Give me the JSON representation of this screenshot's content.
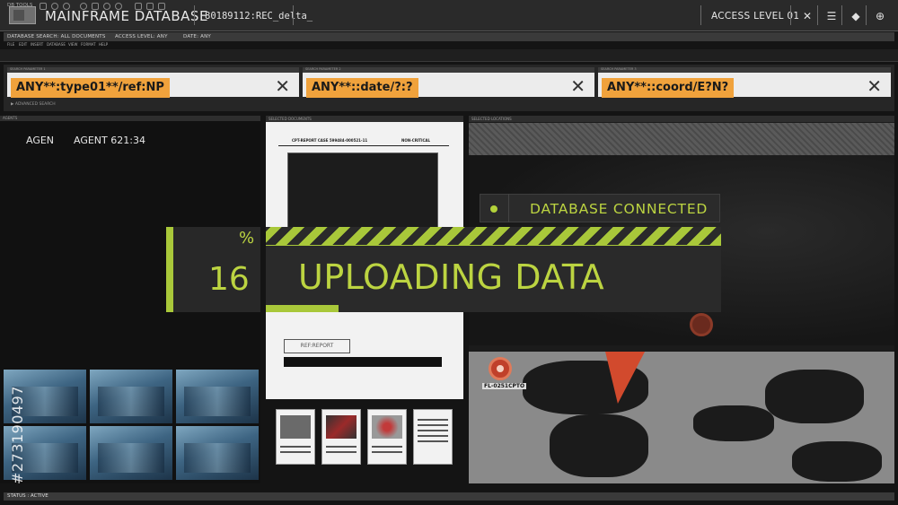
{
  "header": {
    "title": "MAINFRAME DATABASE",
    "record_id": "80189112:REC_delta_",
    "access_level": "ACCESS LEVEL 01",
    "icons": [
      "network-icon",
      "list-icon",
      "layers-icon",
      "globe-icon"
    ]
  },
  "filters": {
    "database_search": "DATABASE SEARCH: ALL DOCUMENTS",
    "access_level": "ACCESS LEVEL: ANY",
    "date": "DATE: ANY"
  },
  "menu": [
    "FILE",
    "EDIT",
    "INSERT",
    "DATABASE",
    "VIEW",
    "FORMAT",
    "HELP"
  ],
  "toolbar": {
    "label": "DB TOOLS"
  },
  "searches": [
    {
      "label": "SEARCH PARAMETER 1",
      "query": "ANY**:type01**/ref:NP"
    },
    {
      "label": "SEARCH PARAMETER 2",
      "query": "ANY**::date/?:?"
    },
    {
      "label": "SEARCH PARAMETER 3",
      "query": "ANY**::coord/E?N?"
    }
  ],
  "advanced_search": "ADVANCED SEARCH",
  "agents": {
    "header": "AGENTS",
    "tag": "AGEN",
    "name": "AGENT 621:34"
  },
  "document": {
    "header": "SELECTED DOCUMENTS",
    "report_title": "CPT-REPORT CASE 599484-000521-11",
    "classification": "NON-CRITICAL",
    "stamp": "REF:REPORT"
  },
  "map": {
    "header": "SELECTED LOCATIONS",
    "pin_label": "FL-0251CPTO"
  },
  "overlay": {
    "connection": "DATABASE CONNECTED",
    "percent_sign": "%",
    "percent": "16",
    "progress": 0.16,
    "message": "UPLOADING DATA"
  },
  "status": "STATUS : ACTIVE",
  "watermark_id": "#273190497",
  "colors": {
    "accent": "#bcd441",
    "query_highlight": "#f0a23c",
    "map_marker": "#d24a2d"
  }
}
